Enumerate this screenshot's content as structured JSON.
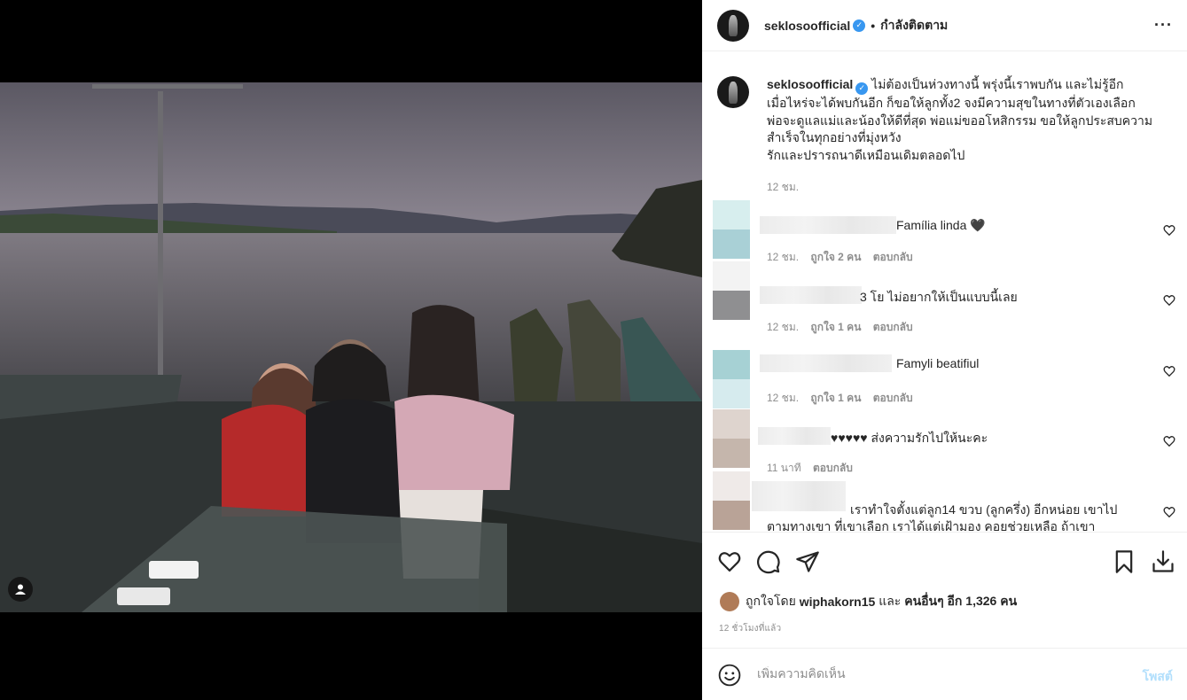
{
  "post": {
    "username": "seklosoofficial",
    "separator": "•",
    "following_label": "กำลังติดตาม",
    "more_label": "···",
    "caption": {
      "lines": [
        "ไม่ต้องเป็นห่วงทางนี้ พรุ่งนี้เราพบกัน และไม่รู้อีก",
        "เมื่อไหร่จะได้พบกันอีก ก็ขอให้ลูกทั้ง2 จงมีความสุขในทางที่ตัวเองเลือก",
        "พ่อจะดูแลแม่และน้องให้ดีที่สุด พ่อแม่ขออโหสิกรรม ขอให้ลูกประสบความ",
        "สำเร็จในทุกอย่างที่มุ่งหวัง",
        "รักและปรารถนาดีเหมือนเดิมตลอดไป"
      ],
      "time": "12 ชม."
    }
  },
  "comments": [
    {
      "text": "Família linda 🖤",
      "time": "12 ชม.",
      "likes": "ถูกใจ 2 คน",
      "reply": "ตอบกลับ",
      "colors": [
        "#d7eeee",
        "#a9d0d6"
      ]
    },
    {
      "text": "3 โย ไม่อยากให้เป็นแบบนี้เลย",
      "time": "12 ชม.",
      "likes": "ถูกใจ 1 คน",
      "reply": "ตอบกลับ",
      "colors": [
        "#f3f3f3",
        "#8f8f91"
      ]
    },
    {
      "text": "Famyli beatifiul",
      "time": "12 ชม.",
      "likes": "ถูกใจ 1 คน",
      "reply": "ตอบกลับ",
      "colors": [
        "#a6d1d4",
        "#d6ebee"
      ]
    },
    {
      "text": "♥♥♥♥♥ ส่งความรักไปให้นะคะ",
      "time": "11 นาที",
      "likes": "",
      "reply": "ตอบกลับ",
      "colors": [
        "#ded4ce",
        "#c5b6ac"
      ]
    },
    {
      "text_line1": "เราทำใจตั้งแต่ลูก14 ขวบ (ลูกครึ่ง) อีกหน่อย เขาไป",
      "text_line2": "ตามทางเขา ที่เขาเลือก เราได้แต่เฝ้ามอง คอยช่วยเหลือ ถ้าเขา",
      "colors": [
        "#efeae8",
        "#b9a397"
      ]
    }
  ],
  "likes": {
    "prefix": "ถูกใจโดย",
    "user": "wiphakorn15",
    "middle": "และ",
    "others": "คนอื่นๆ อีก 1,326 คน"
  },
  "timestamp": "12 ชั่วโมงที่แล้ว",
  "composer": {
    "placeholder": "เพิ่มความคิดเห็น",
    "post_label": "โพสต์"
  },
  "icons": {
    "like": "heart-icon",
    "comment": "comment-icon",
    "share": "share-icon",
    "save": "bookmark-icon",
    "download": "download-icon",
    "emoji": "emoji-icon",
    "tag": "user-tag-icon",
    "verified": "verified-badge-icon"
  },
  "colors": {
    "verified": "#3897f0",
    "post_button": "#b2dffc",
    "secondary_text": "#8e8e8e"
  }
}
